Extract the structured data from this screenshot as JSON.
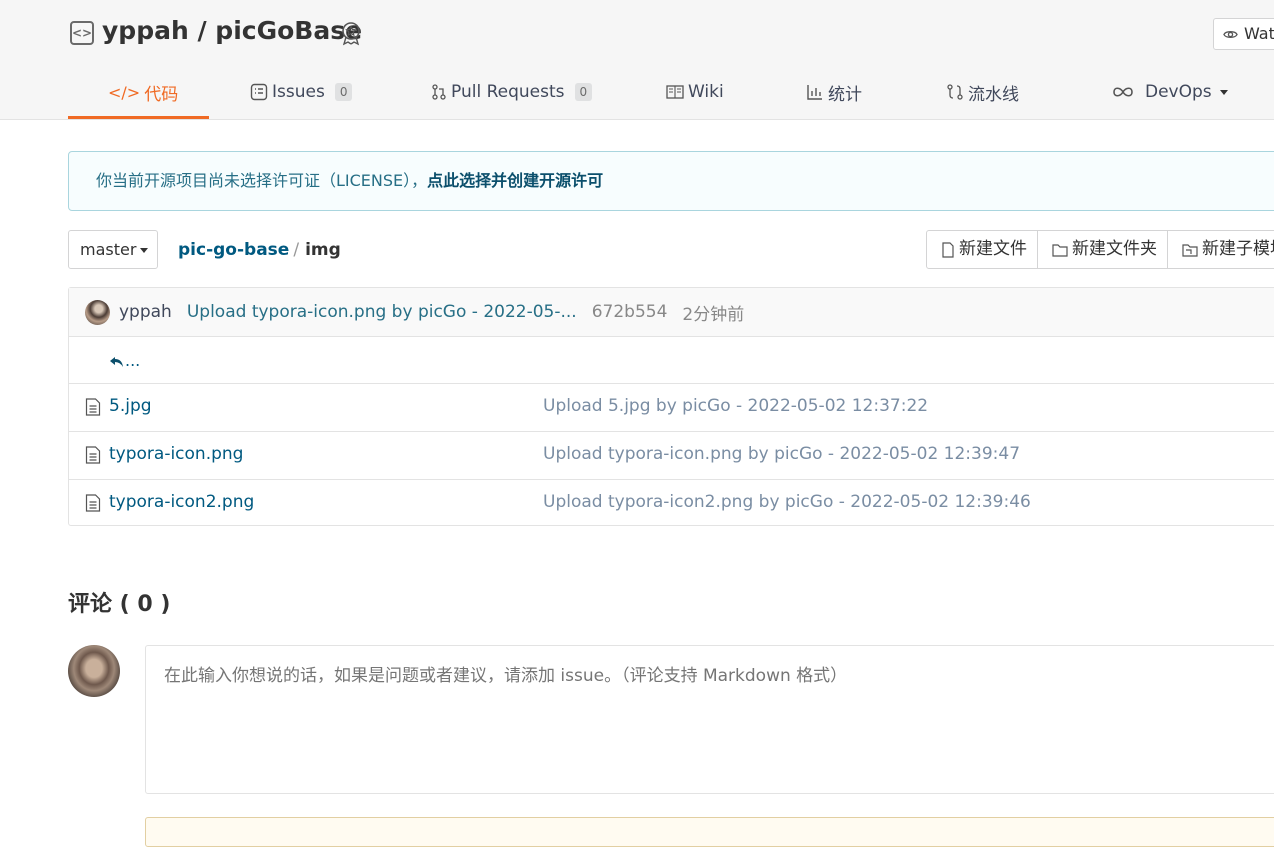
{
  "repo": {
    "owner": "yppah",
    "separator": " / ",
    "name": "picGoBase",
    "title": "yppah / picGoBase",
    "watch_label": "Watch"
  },
  "tabs": [
    {
      "label": "代码",
      "icon": "code-icon",
      "active": true
    },
    {
      "label": "Issues",
      "count": "0",
      "icon": "issues-icon"
    },
    {
      "label": "Pull Requests",
      "count": "0",
      "icon": "pull-request-icon"
    },
    {
      "label": "Wiki",
      "icon": "book-icon"
    },
    {
      "label": "统计",
      "icon": "bar-chart-icon"
    },
    {
      "label": "流水线",
      "icon": "pipeline-icon"
    },
    {
      "label": "DevOps",
      "icon": "infinity-icon"
    }
  ],
  "license_notice": {
    "text": "你当前开源项目尚未选择许可证（LICENSE），",
    "link": "点此选择并创建开源许可"
  },
  "branch": {
    "selected": "master"
  },
  "breadcrumb": {
    "root": "pic-go-base",
    "separator": "/",
    "current": "img"
  },
  "actions": {
    "new_file": "新建文件",
    "new_folder": "新建文件夹",
    "new_submodule": "新建子模块"
  },
  "last_commit": {
    "author": "yppah",
    "message": "Upload typora-icon.png by picGo - 2022-05-...",
    "sha": "672b554",
    "time": "2分钟前"
  },
  "parent_link": "...",
  "files": [
    {
      "name": "5.jpg",
      "message": "Upload 5.jpg by picGo - 2022-05-02 12:37:22"
    },
    {
      "name": "typora-icon.png",
      "message": "Upload typora-icon.png by picGo - 2022-05-02 12:39:47"
    },
    {
      "name": "typora-icon2.png",
      "message": "Upload typora-icon2.png by picGo - 2022-05-02 12:39:46"
    }
  ],
  "comments": {
    "title": "评论 ( 0 )",
    "placeholder": "在此输入你想说的话，如果是问题或者建议，请添加 issue。（评论支持 Markdown 格式）"
  },
  "colors": {
    "accent": "#f06a24",
    "link": "#005980",
    "banner_bg": "#f7fdfe"
  }
}
